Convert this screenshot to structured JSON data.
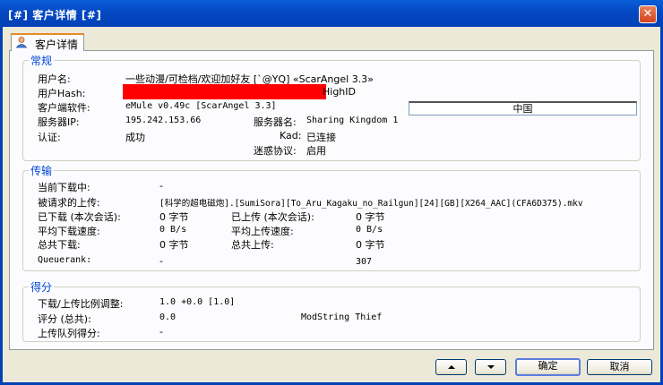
{
  "window": {
    "title": "[#] 客户详情 [#]",
    "close": "✕"
  },
  "tab": {
    "label": "客户详情"
  },
  "general": {
    "title": "常规",
    "username_label": "用户名:",
    "username_value": "一些动漫/可检档/欢迎加好友 [`@YQ] «ScarAngel 3.3»",
    "hash_label": "用户Hash:",
    "id_status": "HighID",
    "client_label": "客户端软件:",
    "client_value": "eMule v0.49c [ScarAngel 3.3]",
    "country": "中国",
    "server_ip_label": "服务器IP:",
    "server_ip_value": "195.242.153.66",
    "server_name_label": "服务器名:",
    "server_name_value": "Sharing Kingdom 1",
    "auth_label": "认证:",
    "auth_value": "成功",
    "kad_label": "Kad:",
    "kad_value": "已连接",
    "obfuscation_label": "迷惑协议:",
    "obfuscation_value": "启用"
  },
  "transfer": {
    "title": "传输",
    "current_dl_label": "当前下载中:",
    "current_dl_value": "-",
    "requested_label": "被请求的上传:",
    "requested_value": "[科学的超电磁炮].[SumiSora][To_Aru_Kagaku_no_Railgun][24][GB][X264_AAC](CFA6D375).mkv",
    "session_dl_label": "已下载 (本次会话):",
    "session_dl_value": "0 字节",
    "session_ul_label": "已上传 (本次会话):",
    "session_ul_value": "0 字节",
    "avg_dl_label": "平均下载速度:",
    "avg_dl_value": "0 B/s",
    "avg_ul_label": "平均上传速度:",
    "avg_ul_value": "0 B/s",
    "total_dl_label": "总共下载:",
    "total_dl_value": "0 字节",
    "total_ul_label": "总共上传:",
    "total_ul_value": "0 字节",
    "queuerank_label": "Queuerank:",
    "queuerank_value": "-",
    "queuerank_num": "307"
  },
  "score": {
    "title": "得分",
    "ratio_label": "下载/上传比例调整:",
    "ratio_value": "1.0 +0.0 [1.0]",
    "rating_label": "评分 (总共):",
    "rating_value": "0.0",
    "modstring": "ModString Thief",
    "queue_score_label": "上传队列得分:",
    "queue_score_value": "-"
  },
  "buttons": {
    "ok": "确定",
    "cancel": "取消"
  }
}
